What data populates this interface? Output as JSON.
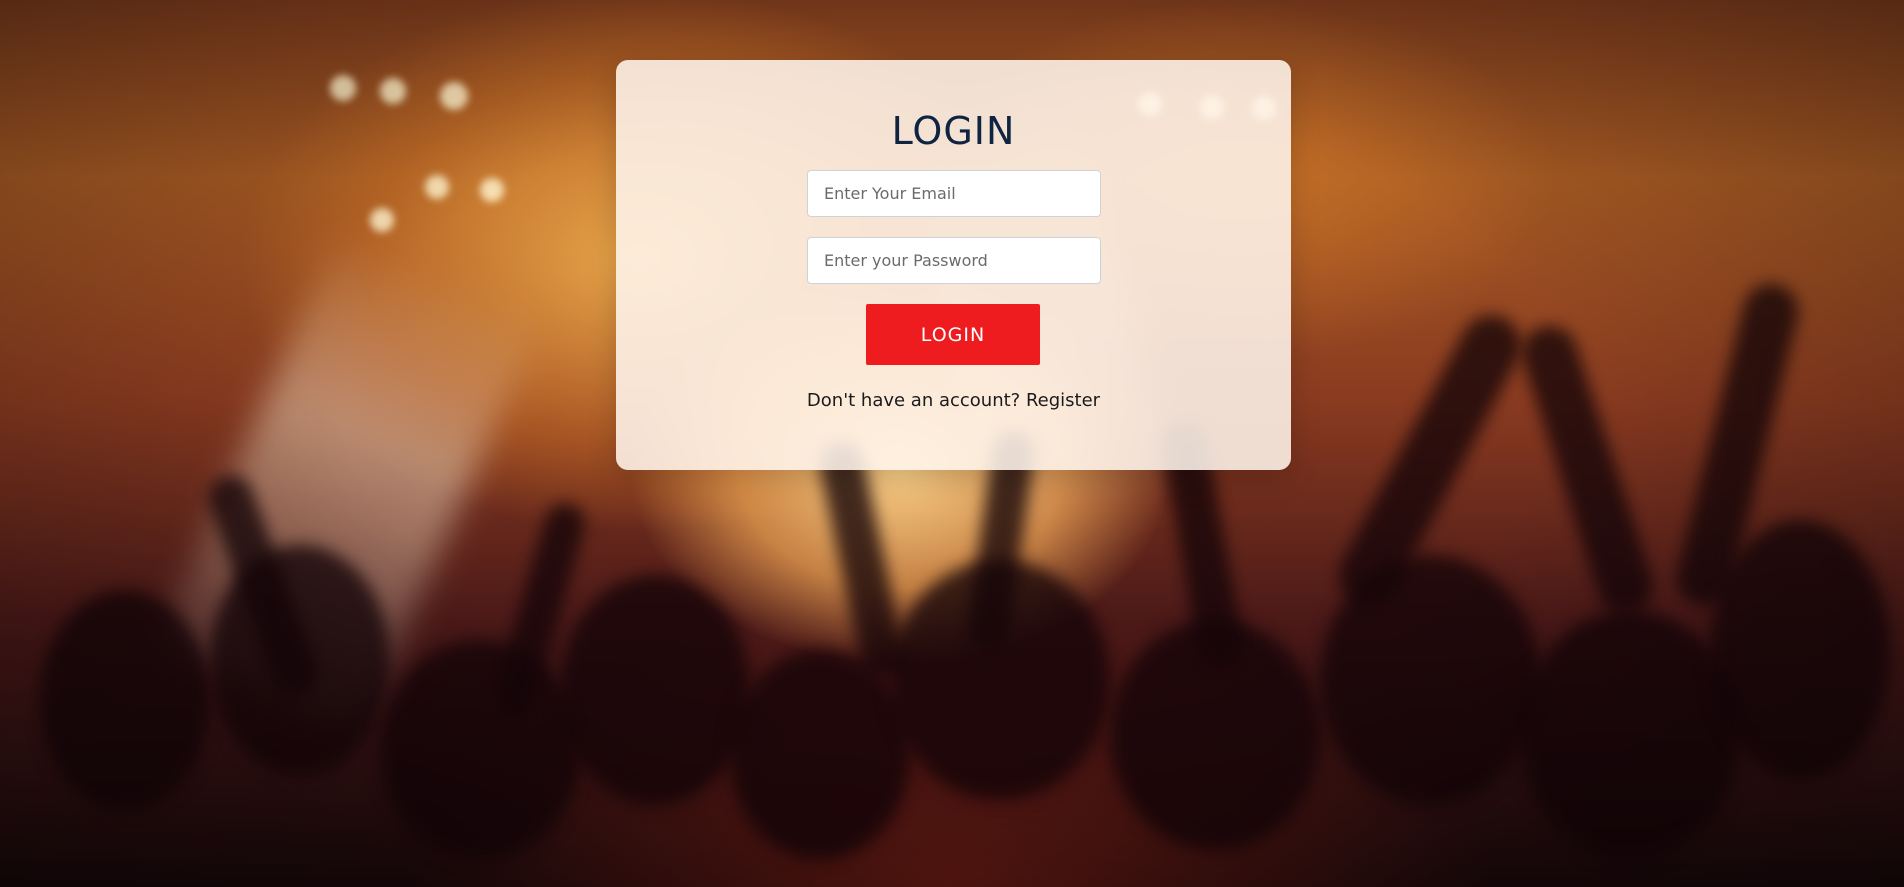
{
  "login": {
    "title": "LOGIN",
    "email_placeholder": "Enter Your Email",
    "password_placeholder": "Enter your Password",
    "button_label": "LOGIN",
    "register_prompt": "Don't have an account?",
    "register_link": "Register"
  },
  "colors": {
    "card_bg": "#fff5ec",
    "title": "#0f2440",
    "button": "#ee1c1f",
    "text": "#1b1b1b"
  }
}
